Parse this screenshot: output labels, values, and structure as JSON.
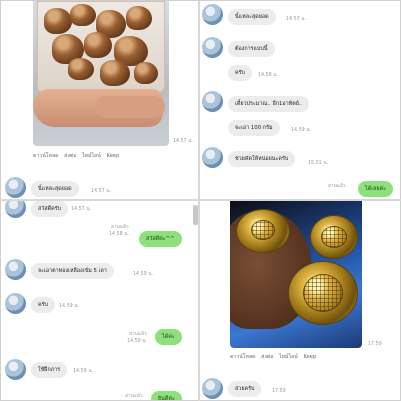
{
  "panel1": {
    "photo_time": "14.57 น.",
    "actions": [
      "ดาวน์โหลด",
      "ส่งต่อ",
      "ไทม์ไลน์",
      "Keep"
    ],
    "message": {
      "text": "นิ้แหละสุดยอด",
      "time": "14.57 น."
    }
  },
  "panel2": {
    "messages": [
      {
        "text": "นิ้แหละสุดยอด",
        "time": "14.57 น."
      },
      {
        "text": "ต้องการแบบนี้",
        "time": ""
      },
      {
        "text": "ครับ",
        "time": "14.58 น."
      },
      {
        "text": "เดี๋ยวประมาณ.. อีก1อาทิตย์..",
        "time": ""
      },
      {
        "text": "จะเอา 100 กรัม",
        "time": "14.59 น."
      },
      {
        "text": "ช่วยคัดให้หน่อยนะครับ",
        "time": "15.01 น."
      }
    ],
    "my_reply": {
      "text": "ได้เลยค่ะ",
      "status": "อ่านแล้ว"
    }
  },
  "panel3": {
    "top_message": {
      "text": "สวัสดีครับ",
      "time": "14.57 น."
    },
    "my_reply_1": {
      "text": "สวัสดีค่ะ^^",
      "status": "อ่านแล้ว",
      "time": "14.58 น."
    },
    "message_2": {
      "text": "จะเอาตาทองเหลืองเข้ม 5 เลา",
      "time": "14.59 น."
    },
    "message_3": {
      "text": "ครับ",
      "time": "14.59 น."
    },
    "my_reply_2": {
      "text": "ได้ค่ะ",
      "status": "อ่านแล้ว",
      "time": "14.59 น."
    },
    "message_4": {
      "text": "ใช้ฝึกภาร",
      "time": "14.59 น."
    },
    "my_reply_3": {
      "text": "ยินดีค่ะ",
      "status": "อ่านแล้ว"
    }
  },
  "panel4": {
    "photo_time": "17.59",
    "actions": [
      "ดาวน์โหลด",
      "ส่งต่อ",
      "ไทม์ไลน์",
      "Keep"
    ],
    "message": {
      "text": "สวยครับ",
      "time": "17.59"
    }
  }
}
